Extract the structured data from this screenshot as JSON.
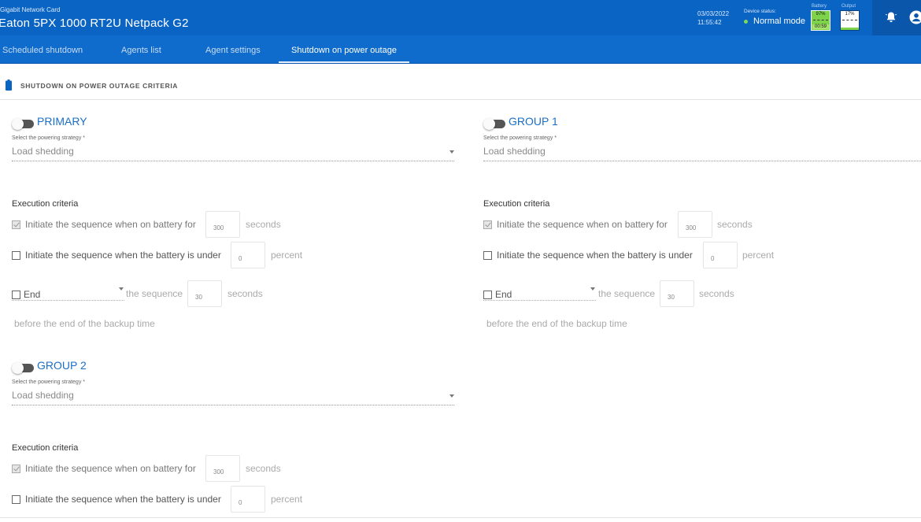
{
  "header": {
    "card_name": "Gigabit Network Card",
    "device_name": "Eaton 5PX 1000 RT2U Netpack G2",
    "date": "03/03/2022",
    "time": "11:55:42",
    "status_label": "Device status:",
    "status_value": "Normal mode",
    "status_color": "#7ed957",
    "battery": {
      "label": "Battery",
      "percent": "97%",
      "runtime": "00:59",
      "color": "#7dd34a"
    },
    "output": {
      "label": "Output",
      "percent": "17%"
    },
    "icons": [
      "bell-icon",
      "user-icon"
    ]
  },
  "tabs": [
    {
      "label": "Scheduled shutdown",
      "active": false
    },
    {
      "label": "Agents list",
      "active": false
    },
    {
      "label": "Agent settings",
      "active": false
    },
    {
      "label": "Shutdown on power outage",
      "active": true
    }
  ],
  "section": {
    "title": "SHUTDOWN ON POWER OUTAGE CRITERIA",
    "icon": "battery-icon"
  },
  "groups": [
    {
      "name": "PRIMARY",
      "strategy_label": "Select the powering strategy *",
      "strategy_value": "Load shedding",
      "exec_title": "Execution criteria",
      "battery_time_text": "Initiate the sequence when on battery for",
      "battery_time_value": "300",
      "battery_time_unit": "seconds",
      "battery_time_checked": true,
      "battery_level_text": "Initiate the sequence when the battery is under",
      "battery_level_value": "0",
      "battery_level_unit": "percent",
      "battery_level_checked": false,
      "end_text": "End",
      "end_sequence_text": "the sequence",
      "end_value": "30",
      "end_unit": "seconds",
      "end_checked": false,
      "backup_text": "before the end of the backup time"
    },
    {
      "name": "GROUP 1",
      "strategy_label": "Select the powering strategy *",
      "strategy_value": "Load shedding",
      "exec_title": "Execution criteria",
      "battery_time_text": "Initiate the sequence when on battery for",
      "battery_time_value": "300",
      "battery_time_unit": "seconds",
      "battery_time_checked": true,
      "battery_level_text": "Initiate the sequence when the battery is under",
      "battery_level_value": "0",
      "battery_level_unit": "percent",
      "battery_level_checked": false,
      "end_text": "End",
      "end_sequence_text": "the sequence",
      "end_value": "30",
      "end_unit": "seconds",
      "end_checked": false,
      "backup_text": "before the end of the backup time"
    },
    {
      "name": "GROUP 2",
      "strategy_label": "Select the powering strategy *",
      "strategy_value": "Load shedding",
      "exec_title": "Execution criteria",
      "battery_time_text": "Initiate the sequence when on battery for",
      "battery_time_value": "300",
      "battery_time_unit": "seconds",
      "battery_time_checked": true,
      "battery_level_text": "Initiate the sequence when the battery is under",
      "battery_level_value": "0",
      "battery_level_unit": "percent",
      "battery_level_checked": false
    }
  ]
}
